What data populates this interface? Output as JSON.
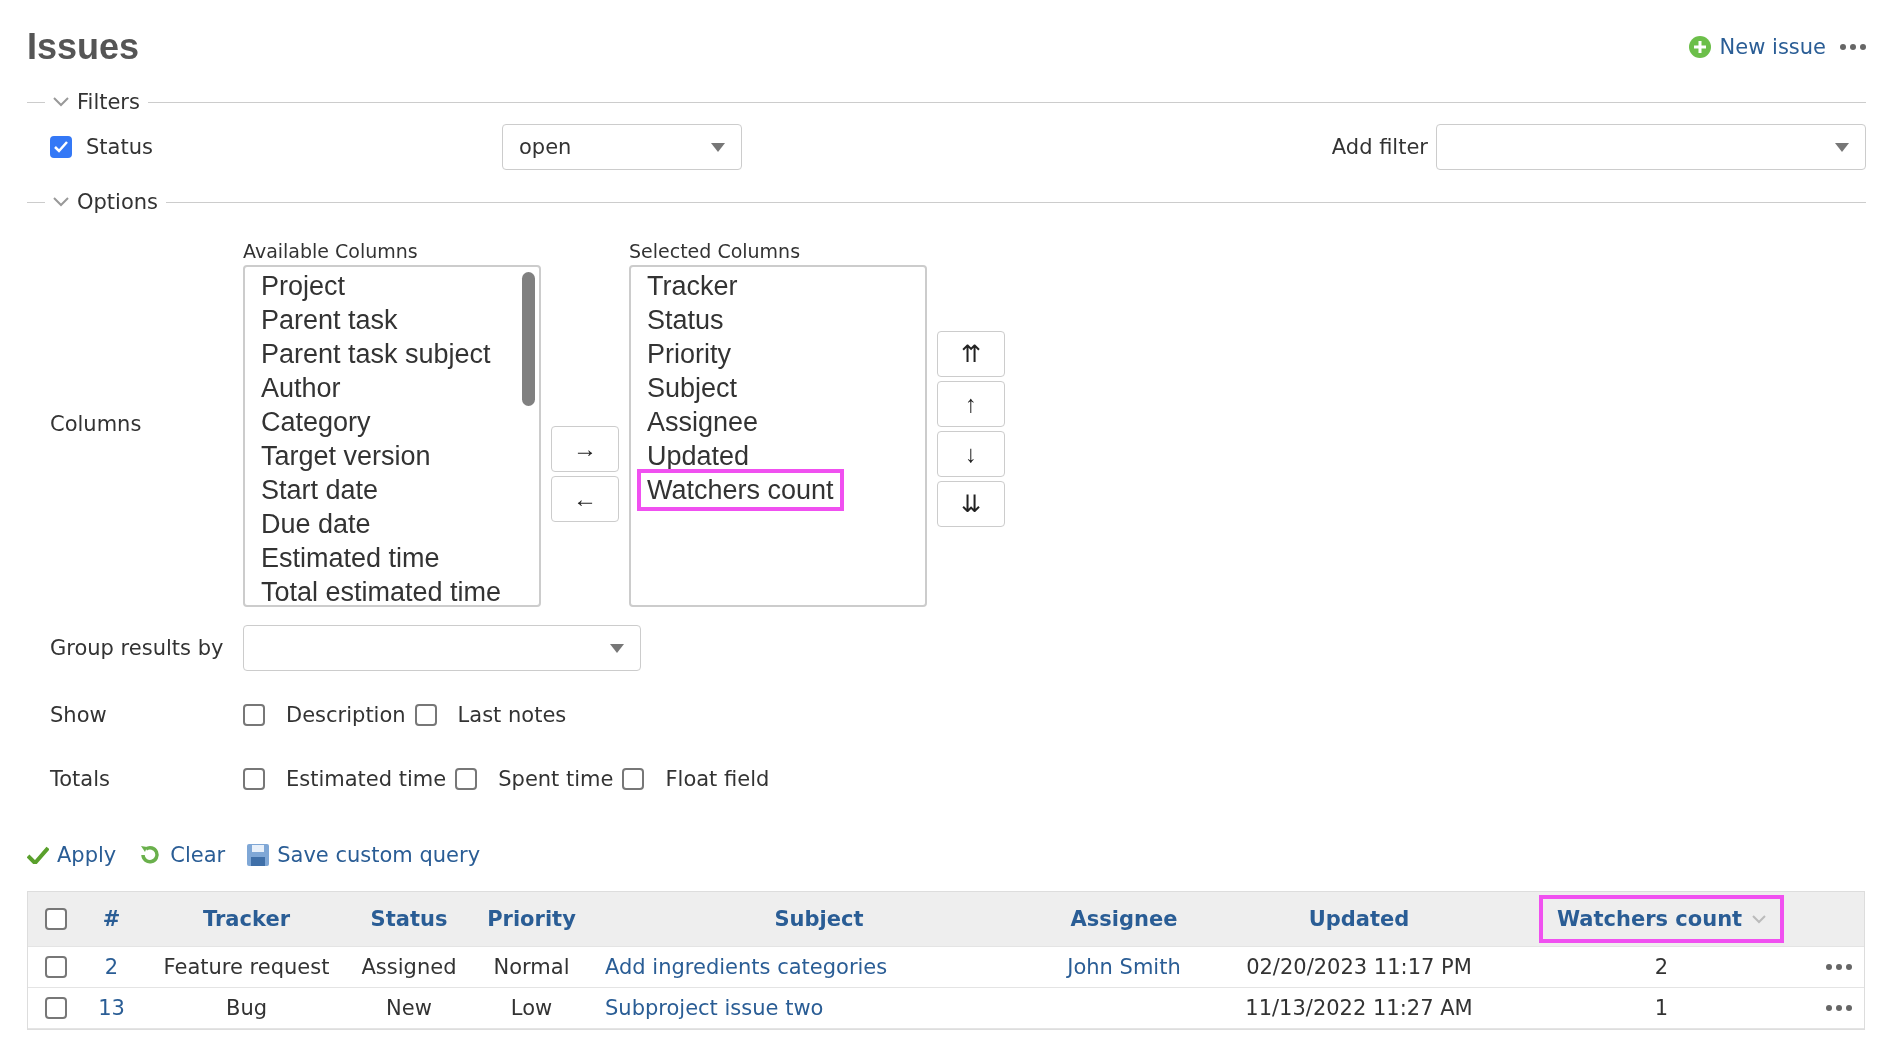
{
  "header": {
    "title": "Issues",
    "new_issue": "New issue"
  },
  "filters": {
    "legend": "Filters",
    "expanded": true,
    "rows": [
      {
        "label": "Status",
        "checked": true,
        "operator": "open"
      }
    ],
    "add_filter_label": "Add filter"
  },
  "options": {
    "legend": "Options",
    "expanded": true,
    "columns_label": "Columns",
    "available_label": "Available Columns",
    "available": [
      "Project",
      "Parent task",
      "Parent task subject",
      "Author",
      "Category",
      "Target version",
      "Start date",
      "Due date",
      "Estimated time",
      "Total estimated time"
    ],
    "move_buttons": [
      "→",
      "←"
    ],
    "selected_label": "Selected Columns",
    "selected": [
      {
        "label": "Tracker",
        "highlighted": false
      },
      {
        "label": "Status",
        "highlighted": false
      },
      {
        "label": "Priority",
        "highlighted": false
      },
      {
        "label": "Subject",
        "highlighted": false
      },
      {
        "label": "Assignee",
        "highlighted": false
      },
      {
        "label": "Updated",
        "highlighted": false
      },
      {
        "label": "Watchers count",
        "highlighted": true
      }
    ],
    "order_buttons": [
      "⇈",
      "↑",
      "↓",
      "⇊"
    ],
    "group_label": "Group results by",
    "show_label": "Show",
    "show": [
      {
        "label": "Description",
        "checked": false
      },
      {
        "label": "Last notes",
        "checked": false
      }
    ],
    "totals_label": "Totals",
    "totals": [
      {
        "label": "Estimated time",
        "checked": false
      },
      {
        "label": "Spent time",
        "checked": false
      },
      {
        "label": "Float field",
        "checked": false
      }
    ]
  },
  "actions": [
    {
      "label": "Apply",
      "kind": "apply"
    },
    {
      "label": "Clear",
      "kind": "clear"
    },
    {
      "label": "Save custom query",
      "kind": "save"
    }
  ],
  "table": {
    "select_all_checked": false,
    "columns": [
      {
        "label": "#",
        "kind": "link",
        "highlighted": false,
        "sorted": false
      },
      {
        "label": "Tracker",
        "kind": "text",
        "highlighted": false,
        "sorted": false
      },
      {
        "label": "Status",
        "kind": "text",
        "highlighted": false,
        "sorted": false
      },
      {
        "label": "Priority",
        "kind": "text",
        "highlighted": false,
        "sorted": false
      },
      {
        "label": "Subject",
        "kind": "subject",
        "highlighted": false,
        "sorted": false
      },
      {
        "label": "Assignee",
        "kind": "link",
        "highlighted": false,
        "sorted": false
      },
      {
        "label": "Updated",
        "kind": "text",
        "highlighted": false,
        "sorted": false
      },
      {
        "label": "Watchers count",
        "kind": "text",
        "highlighted": true,
        "sorted": true
      }
    ],
    "rows": [
      {
        "checked": false,
        "cells": [
          "2",
          "Feature request",
          "Assigned",
          "Normal",
          "Add ingredients categories",
          "John Smith",
          "02/20/2023 11:17 PM",
          "2"
        ]
      },
      {
        "checked": false,
        "cells": [
          "13",
          "Bug",
          "New",
          "Low",
          "Subproject issue two",
          null,
          "11/13/2022 11:27 AM",
          "1"
        ]
      }
    ]
  }
}
